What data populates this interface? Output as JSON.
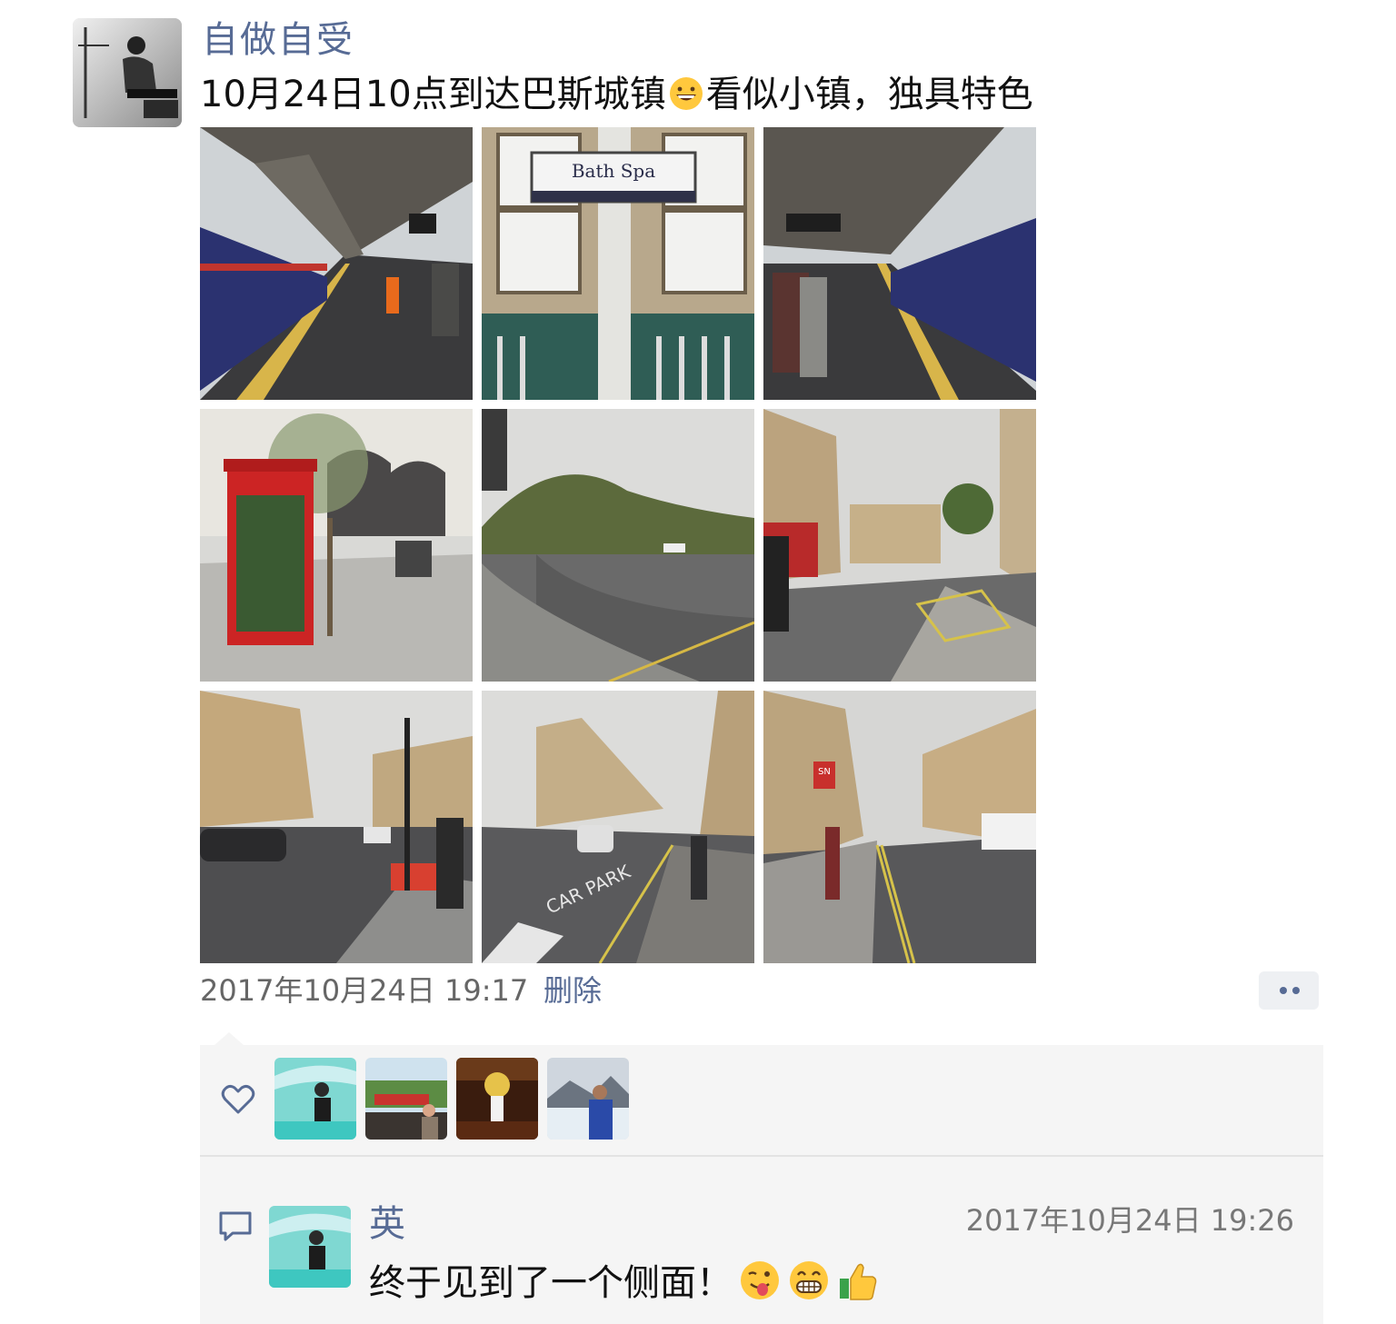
{
  "post": {
    "author": "自做自受",
    "text_before_emoji": "10月24日10点到达巴斯城镇",
    "emoji_inline": "grinning-face",
    "text_after_emoji": "看似小镇，独具特色",
    "photo_sign_text": "Bath Spa",
    "photo_road_marking": "CAR PARK",
    "photo_shop_sign": "SN",
    "timestamp": "2017年10月24日 19:17",
    "delete_label": "删除",
    "more_icon": "more-dots-icon"
  },
  "likes": {
    "icon": "heart-icon",
    "likers": [
      "liker-1",
      "liker-2",
      "liker-3",
      "liker-4"
    ]
  },
  "comments": [
    {
      "name": "英",
      "time": "2017年10月24日 19:26",
      "text": "终于见到了一个侧面！",
      "emojis": [
        "wink-tongue-emoji",
        "grin-emoji",
        "thumbs-up-emoji"
      ]
    }
  ],
  "colors": {
    "link": "#576b95",
    "panel": "#f5f5f5",
    "meta": "#666666"
  }
}
